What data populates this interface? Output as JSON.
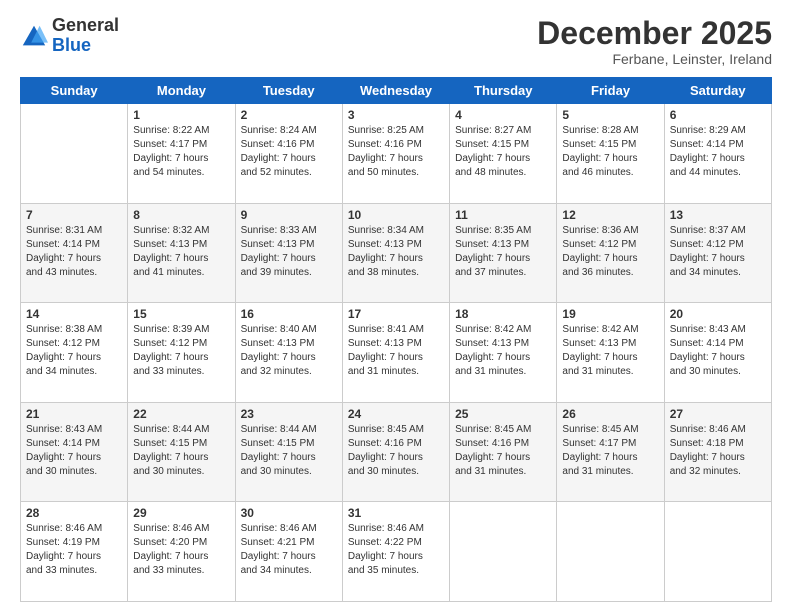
{
  "logo": {
    "general": "General",
    "blue": "Blue"
  },
  "header": {
    "month": "December 2025",
    "location": "Ferbane, Leinster, Ireland"
  },
  "days_of_week": [
    "Sunday",
    "Monday",
    "Tuesday",
    "Wednesday",
    "Thursday",
    "Friday",
    "Saturday"
  ],
  "weeks": [
    [
      {
        "day": "",
        "info": ""
      },
      {
        "day": "1",
        "info": "Sunrise: 8:22 AM\nSunset: 4:17 PM\nDaylight: 7 hours\nand 54 minutes."
      },
      {
        "day": "2",
        "info": "Sunrise: 8:24 AM\nSunset: 4:16 PM\nDaylight: 7 hours\nand 52 minutes."
      },
      {
        "day": "3",
        "info": "Sunrise: 8:25 AM\nSunset: 4:16 PM\nDaylight: 7 hours\nand 50 minutes."
      },
      {
        "day": "4",
        "info": "Sunrise: 8:27 AM\nSunset: 4:15 PM\nDaylight: 7 hours\nand 48 minutes."
      },
      {
        "day": "5",
        "info": "Sunrise: 8:28 AM\nSunset: 4:15 PM\nDaylight: 7 hours\nand 46 minutes."
      },
      {
        "day": "6",
        "info": "Sunrise: 8:29 AM\nSunset: 4:14 PM\nDaylight: 7 hours\nand 44 minutes."
      }
    ],
    [
      {
        "day": "7",
        "info": "Sunrise: 8:31 AM\nSunset: 4:14 PM\nDaylight: 7 hours\nand 43 minutes."
      },
      {
        "day": "8",
        "info": "Sunrise: 8:32 AM\nSunset: 4:13 PM\nDaylight: 7 hours\nand 41 minutes."
      },
      {
        "day": "9",
        "info": "Sunrise: 8:33 AM\nSunset: 4:13 PM\nDaylight: 7 hours\nand 39 minutes."
      },
      {
        "day": "10",
        "info": "Sunrise: 8:34 AM\nSunset: 4:13 PM\nDaylight: 7 hours\nand 38 minutes."
      },
      {
        "day": "11",
        "info": "Sunrise: 8:35 AM\nSunset: 4:13 PM\nDaylight: 7 hours\nand 37 minutes."
      },
      {
        "day": "12",
        "info": "Sunrise: 8:36 AM\nSunset: 4:12 PM\nDaylight: 7 hours\nand 36 minutes."
      },
      {
        "day": "13",
        "info": "Sunrise: 8:37 AM\nSunset: 4:12 PM\nDaylight: 7 hours\nand 34 minutes."
      }
    ],
    [
      {
        "day": "14",
        "info": "Sunrise: 8:38 AM\nSunset: 4:12 PM\nDaylight: 7 hours\nand 34 minutes."
      },
      {
        "day": "15",
        "info": "Sunrise: 8:39 AM\nSunset: 4:12 PM\nDaylight: 7 hours\nand 33 minutes."
      },
      {
        "day": "16",
        "info": "Sunrise: 8:40 AM\nSunset: 4:13 PM\nDaylight: 7 hours\nand 32 minutes."
      },
      {
        "day": "17",
        "info": "Sunrise: 8:41 AM\nSunset: 4:13 PM\nDaylight: 7 hours\nand 31 minutes."
      },
      {
        "day": "18",
        "info": "Sunrise: 8:42 AM\nSunset: 4:13 PM\nDaylight: 7 hours\nand 31 minutes."
      },
      {
        "day": "19",
        "info": "Sunrise: 8:42 AM\nSunset: 4:13 PM\nDaylight: 7 hours\nand 31 minutes."
      },
      {
        "day": "20",
        "info": "Sunrise: 8:43 AM\nSunset: 4:14 PM\nDaylight: 7 hours\nand 30 minutes."
      }
    ],
    [
      {
        "day": "21",
        "info": "Sunrise: 8:43 AM\nSunset: 4:14 PM\nDaylight: 7 hours\nand 30 minutes."
      },
      {
        "day": "22",
        "info": "Sunrise: 8:44 AM\nSunset: 4:15 PM\nDaylight: 7 hours\nand 30 minutes."
      },
      {
        "day": "23",
        "info": "Sunrise: 8:44 AM\nSunset: 4:15 PM\nDaylight: 7 hours\nand 30 minutes."
      },
      {
        "day": "24",
        "info": "Sunrise: 8:45 AM\nSunset: 4:16 PM\nDaylight: 7 hours\nand 30 minutes."
      },
      {
        "day": "25",
        "info": "Sunrise: 8:45 AM\nSunset: 4:16 PM\nDaylight: 7 hours\nand 31 minutes."
      },
      {
        "day": "26",
        "info": "Sunrise: 8:45 AM\nSunset: 4:17 PM\nDaylight: 7 hours\nand 31 minutes."
      },
      {
        "day": "27",
        "info": "Sunrise: 8:46 AM\nSunset: 4:18 PM\nDaylight: 7 hours\nand 32 minutes."
      }
    ],
    [
      {
        "day": "28",
        "info": "Sunrise: 8:46 AM\nSunset: 4:19 PM\nDaylight: 7 hours\nand 33 minutes."
      },
      {
        "day": "29",
        "info": "Sunrise: 8:46 AM\nSunset: 4:20 PM\nDaylight: 7 hours\nand 33 minutes."
      },
      {
        "day": "30",
        "info": "Sunrise: 8:46 AM\nSunset: 4:21 PM\nDaylight: 7 hours\nand 34 minutes."
      },
      {
        "day": "31",
        "info": "Sunrise: 8:46 AM\nSunset: 4:22 PM\nDaylight: 7 hours\nand 35 minutes."
      },
      {
        "day": "",
        "info": ""
      },
      {
        "day": "",
        "info": ""
      },
      {
        "day": "",
        "info": ""
      }
    ]
  ]
}
